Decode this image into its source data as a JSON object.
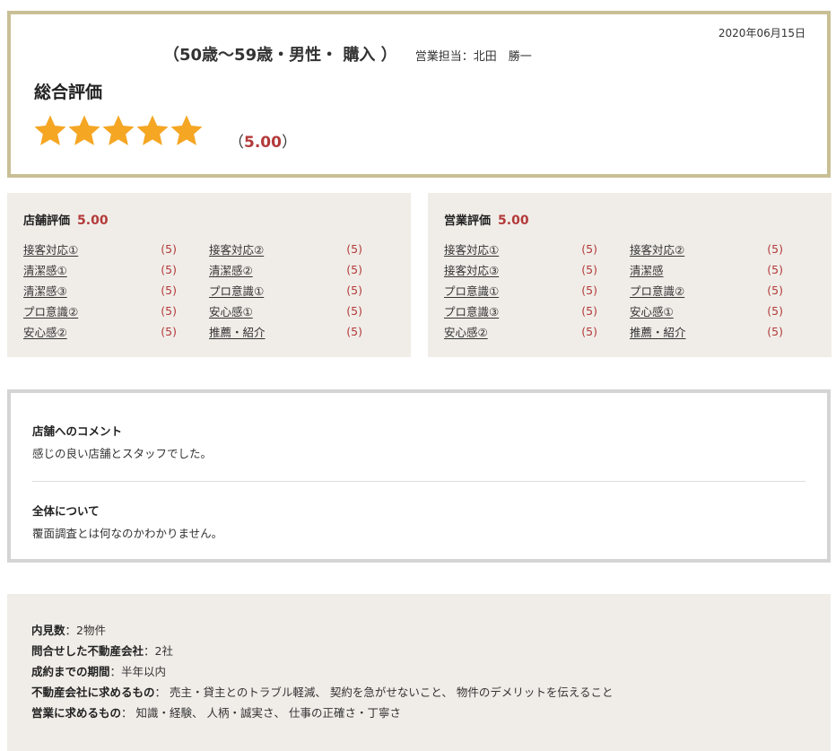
{
  "review": {
    "date": "2020年06月15日",
    "profile": "（50歳〜59歳・男性・ 購入 ）",
    "sales_rep": "営業担当：北田　勝一",
    "overall_title": "総合評価",
    "overall_rating": 5,
    "overall_score_text": "5.00",
    "star_color": "#f5a623"
  },
  "store_eval": {
    "title": "店舗評価",
    "score": "5.00",
    "items": [
      {
        "label": "接客対応①",
        "value": "(5)"
      },
      {
        "label": "接客対応②",
        "value": "(5)"
      },
      {
        "label": "清潔感①",
        "value": "(5)"
      },
      {
        "label": "清潔感②",
        "value": "(5)"
      },
      {
        "label": "清潔感③",
        "value": "(5)"
      },
      {
        "label": "プロ意識①",
        "value": "(5)"
      },
      {
        "label": "プロ意識②",
        "value": "(5)"
      },
      {
        "label": "安心感①",
        "value": "(5)"
      },
      {
        "label": "安心感②",
        "value": "(5)"
      },
      {
        "label": "推薦・紹介",
        "value": "(5)"
      }
    ]
  },
  "sales_eval": {
    "title": "営業評価",
    "score": "5.00",
    "items": [
      {
        "label": "接客対応①",
        "value": "(5)"
      },
      {
        "label": "接客対応②",
        "value": "(5)"
      },
      {
        "label": "接客対応③",
        "value": "(5)"
      },
      {
        "label": "清潔感",
        "value": "(5)"
      },
      {
        "label": "プロ意識①",
        "value": "(5)"
      },
      {
        "label": "プロ意識②",
        "value": "(5)"
      },
      {
        "label": "プロ意識③",
        "value": "(5)"
      },
      {
        "label": "安心感①",
        "value": "(5)"
      },
      {
        "label": "安心感②",
        "value": "(5)"
      },
      {
        "label": "推薦・紹介",
        "value": "(5)"
      }
    ]
  },
  "comments": {
    "store_title": "店舗へのコメント",
    "store_body": "感じの良い店舗とスタッフでした。",
    "overall_title": "全体について",
    "overall_body": "覆面調査とは何なのかわかりません。"
  },
  "info": [
    {
      "key": "内見数",
      "value": "2物件"
    },
    {
      "key": "問合せした不動産会社",
      "value": "2社"
    },
    {
      "key": "成約までの期間",
      "value": "半年以内"
    },
    {
      "key": "不動産会社に求めるもの",
      "value": " 売主・貸主とのトラブル軽減、 契約を急がせないこと、 物件のデメリットを伝えること"
    },
    {
      "key": "営業に求めるもの",
      "value": " 知識・経験、 人柄・誠実さ、 仕事の正確さ・丁寧さ"
    }
  ]
}
